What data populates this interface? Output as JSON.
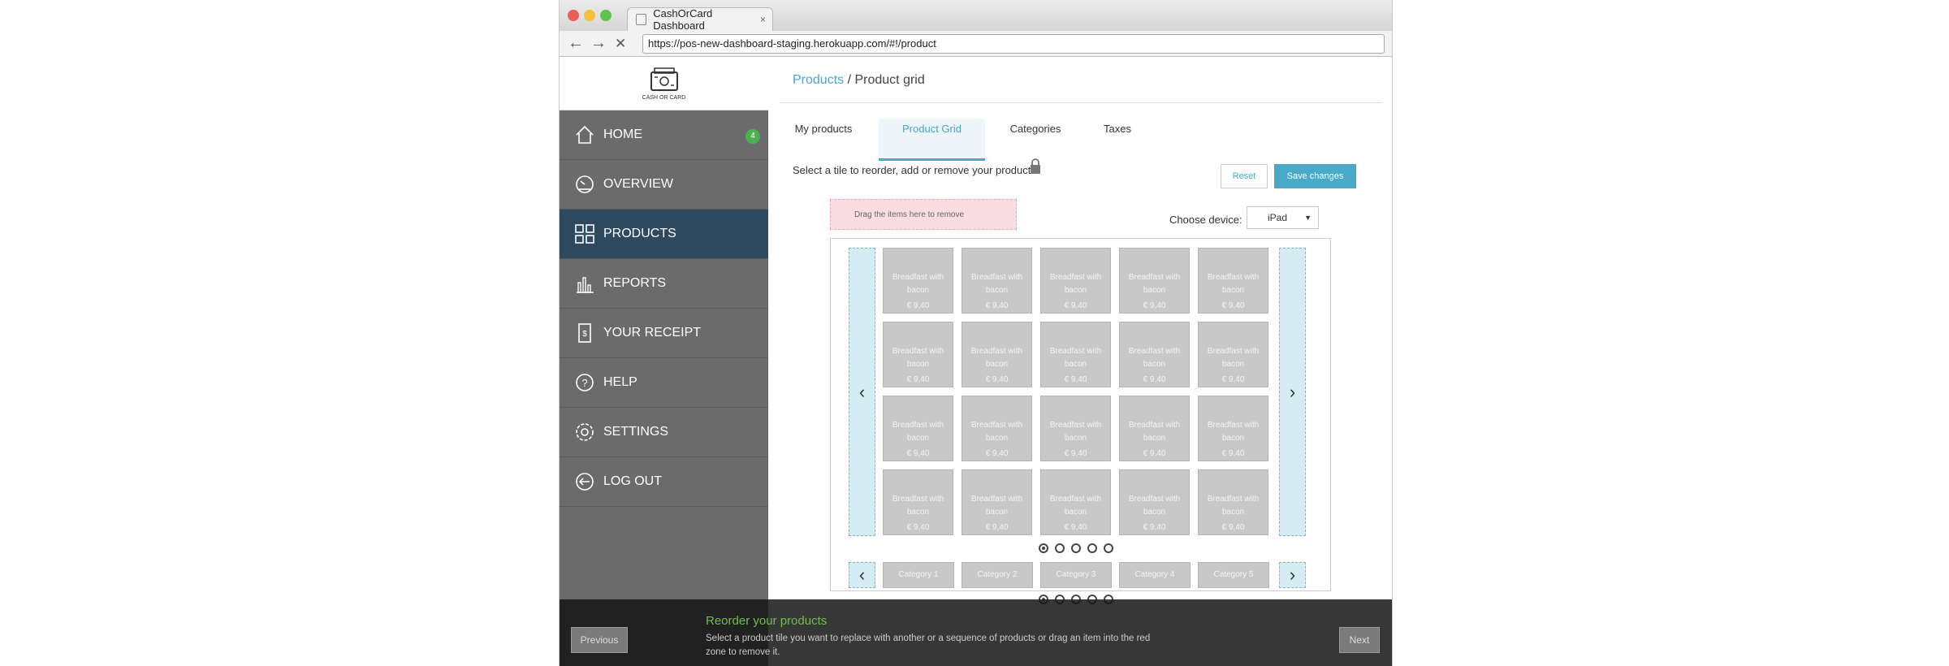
{
  "browser": {
    "tab_title": "CashOrCard Dashboard",
    "tab_close": "×",
    "url": "https://pos-new-dashboard-staging.herokuapp.com/#!/product",
    "back": "←",
    "forward": "→",
    "stop": "✕",
    "traffic_colors": [
      "#ec5f55",
      "#f5be3b",
      "#5fc44e"
    ]
  },
  "logo": {
    "text": "CASH OR CARD"
  },
  "sidebar": {
    "items": [
      {
        "label": "HOME",
        "icon": "home-icon",
        "badge": "4"
      },
      {
        "label": "OVERVIEW",
        "icon": "gauge-icon"
      },
      {
        "label": "PRODUCTS",
        "icon": "grid-icon",
        "active": true
      },
      {
        "label": "REPORTS",
        "icon": "bar-chart-icon"
      },
      {
        "label": "YOUR RECEIPT",
        "icon": "receipt-icon"
      },
      {
        "label": "HELP",
        "icon": "help-icon"
      },
      {
        "label": "SETTINGS",
        "icon": "gear-icon"
      },
      {
        "label": "LOG OUT",
        "icon": "logout-icon"
      }
    ]
  },
  "breadcrumb": {
    "link": "Products",
    "separator": " / ",
    "current": "Product grid"
  },
  "tabs": [
    {
      "label": "My products"
    },
    {
      "label": "Product Grid",
      "active": true
    },
    {
      "label": "Categories"
    },
    {
      "label": "Taxes"
    }
  ],
  "instructions": "Select a tile to reorder, add or remove your products.",
  "buttons": {
    "reset": "Reset",
    "save": "Save changes"
  },
  "drop_zone": "Drag the items here to remove",
  "device": {
    "label": "Choose device:",
    "selected": "iPad"
  },
  "arrows": {
    "left": "‹",
    "right": "›"
  },
  "tile": {
    "name": "Breadfast with bacon",
    "price": "€ 9,40",
    "rows": 4,
    "cols": 5
  },
  "pagination": {
    "count": 5,
    "active": 0
  },
  "categories": [
    "Category 1",
    "Category 2",
    "Category 3",
    "Category 4",
    "Category 5"
  ],
  "tutorial": {
    "title": "Reorder your products",
    "text": "Select a product tile you want to replace with another or a sequence of products or drag an item into the red zone to remove it.",
    "previous": "Previous",
    "next": "Next"
  },
  "colors": {
    "accent": "#4aa8c9",
    "sidebar": "#6b6b6b",
    "sidebar_active": "#2d4a61",
    "success": "#6cc04a"
  }
}
